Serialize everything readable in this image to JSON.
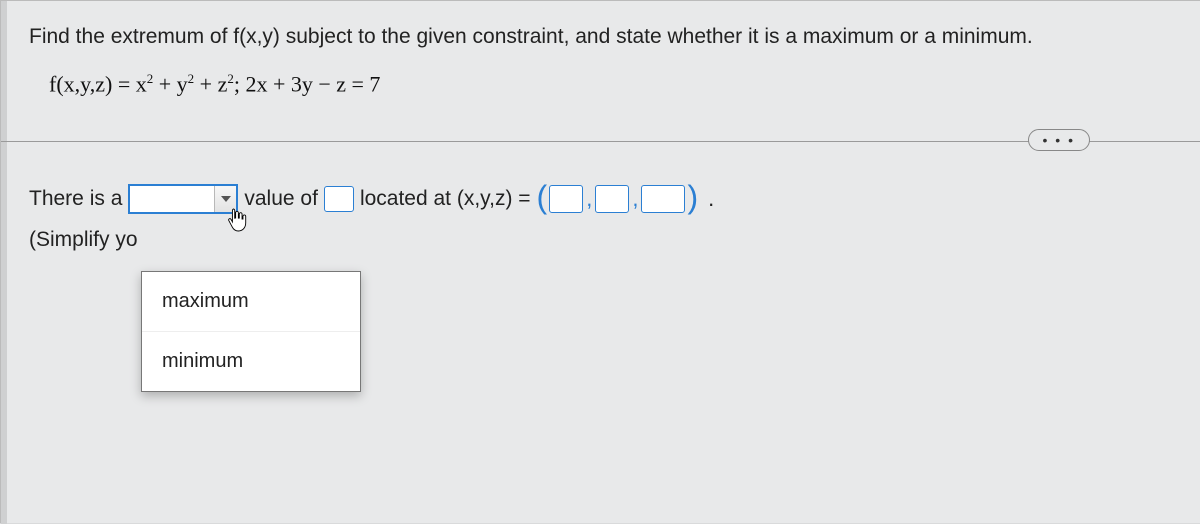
{
  "prompt": "Find the extremum of f(x,y) subject to the given constraint, and state whether it is a maximum or a minimum.",
  "formula_html": "f(x,y,z) = x<sup>2</sup> + y<sup>2</sup> + z<sup>2</sup>; 2x + 3y − z = 7",
  "ellipsis": "• • •",
  "answer": {
    "lead": "There is a",
    "value_of": "value of",
    "located_at": "located at (x,y,z) =",
    "period": ".",
    "simplify": "(Simplify yo"
  },
  "dropdown": {
    "selected": "",
    "options": [
      "maximum",
      "minimum"
    ]
  }
}
